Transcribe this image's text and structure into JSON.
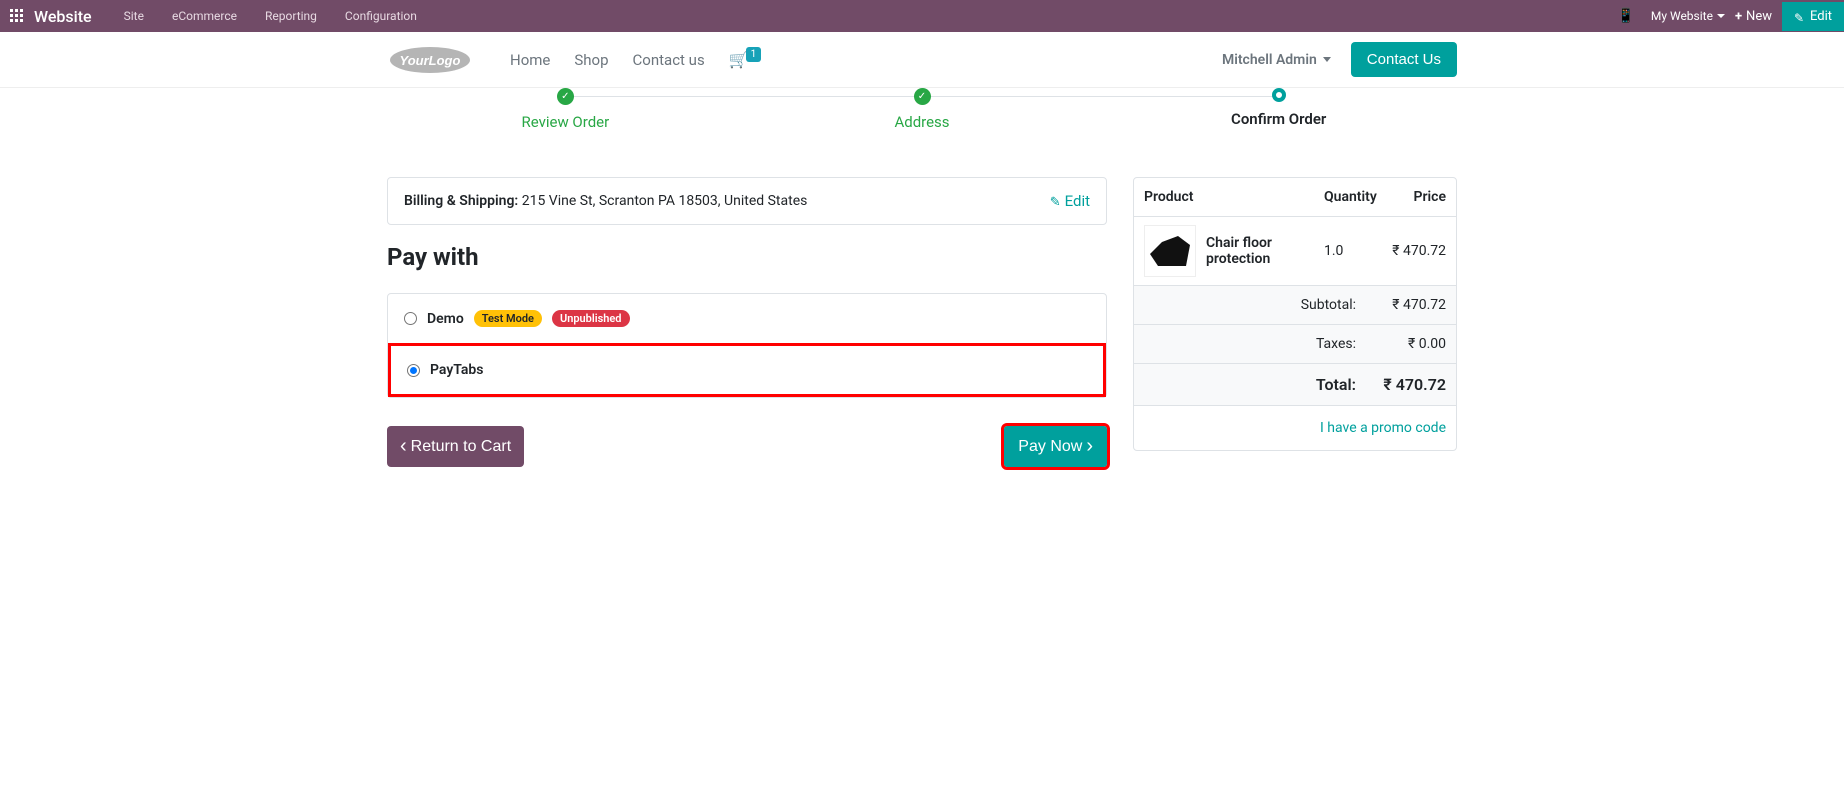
{
  "topbar": {
    "brand": "Website",
    "menu": [
      "Site",
      "eCommerce",
      "Reporting",
      "Configuration"
    ],
    "my_website": "My Website",
    "new": "New",
    "edit": "Edit"
  },
  "header": {
    "nav": [
      "Home",
      "Shop",
      "Contact us"
    ],
    "cart_count": "1",
    "user": "Mitchell Admin",
    "contact_btn": "Contact Us"
  },
  "wizard": {
    "step1": "Review Order",
    "step2": "Address",
    "step3": "Confirm Order"
  },
  "billing": {
    "label": "Billing & Shipping:",
    "address": " 215 Vine St, Scranton PA 18503, United States",
    "edit": "Edit"
  },
  "pay_with": "Pay with",
  "payment": {
    "demo": "Demo",
    "test_mode": "Test Mode",
    "unpublished": "Unpublished",
    "paytabs": "PayTabs"
  },
  "actions": {
    "return": "Return to Cart",
    "paynow": "Pay Now"
  },
  "summary": {
    "hdr_product": "Product",
    "hdr_qty": "Quantity",
    "hdr_price": "Price",
    "item_name": "Chair floor protection",
    "item_qty": "1.0",
    "item_price": "₹ 470.72",
    "subtotal_label": "Subtotal:",
    "subtotal_val": "₹ 470.72",
    "taxes_label": "Taxes:",
    "taxes_val": "₹ 0.00",
    "total_label": "Total:",
    "total_val": "₹ 470.72",
    "promo": "I have a promo code"
  }
}
